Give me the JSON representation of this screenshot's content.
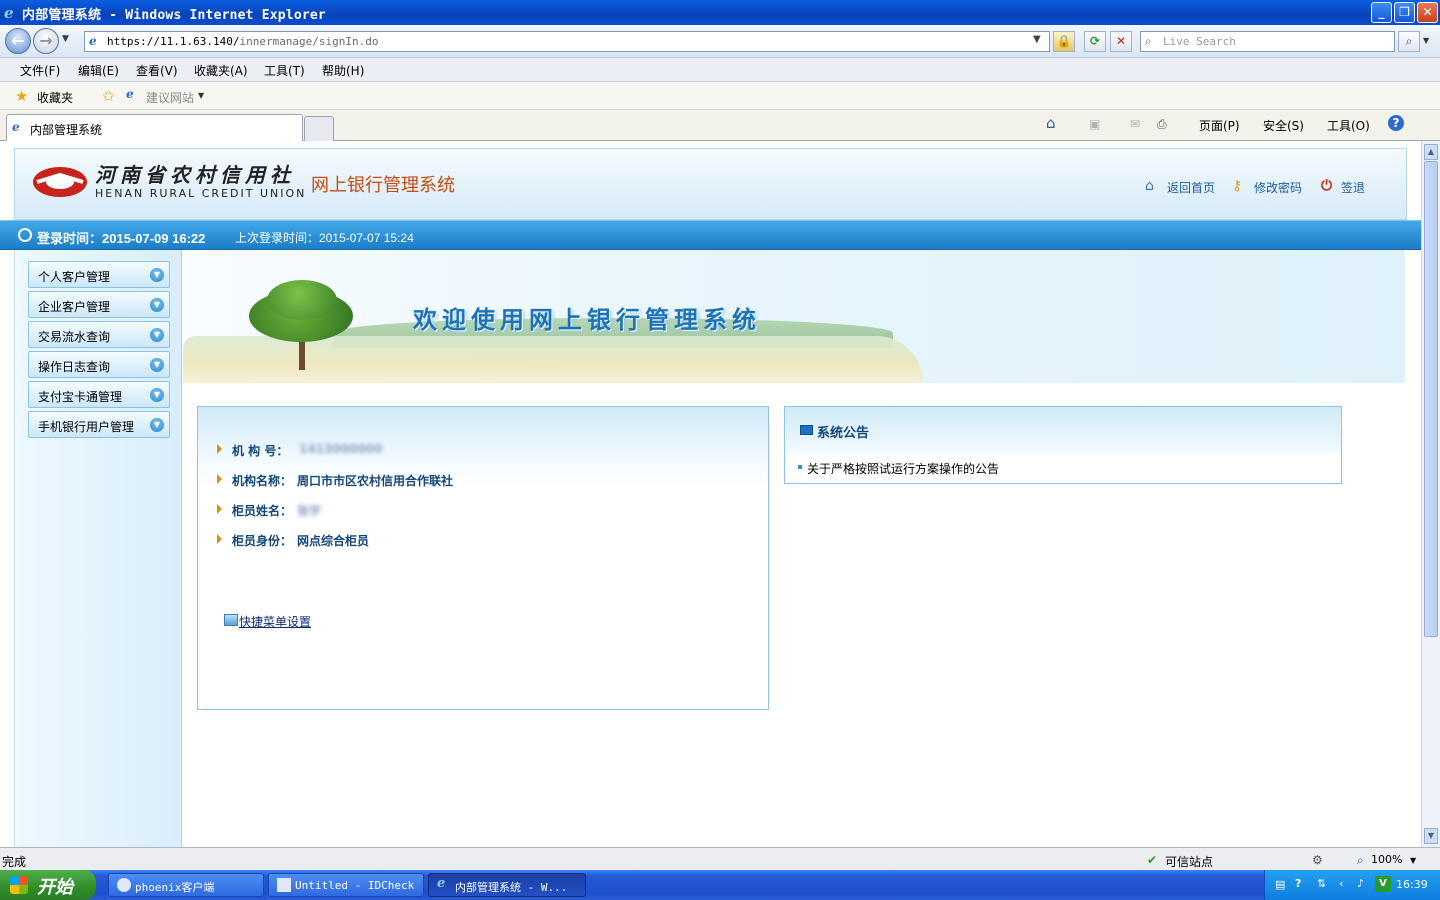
{
  "window": {
    "title": "内部管理系统 - Windows Internet Explorer"
  },
  "browser": {
    "url_scheme_host": "https://11.1.63.140/",
    "url_path": "innermanage/signIn.do",
    "search_placeholder": "Live Search",
    "menu": [
      "文件(F)",
      "编辑(E)",
      "查看(V)",
      "收藏夹(A)",
      "工具(T)",
      "帮助(H)"
    ],
    "favorites_label": "收藏夹",
    "suggested_sites": "建议网站",
    "tab_title": "内部管理系统",
    "commands": {
      "page": "页面(P)",
      "safety": "安全(S)",
      "tools": "工具(O)"
    },
    "status_text": "完成",
    "trusted_zone": "可信站点",
    "zoom": "100%"
  },
  "site": {
    "logo_cn": "河南省农村信用社",
    "logo_en": "HENAN RURAL CREDIT UNION",
    "system_title": "网上银行管理系统",
    "header_links": {
      "home": "返回首页",
      "change_password": "修改密码",
      "logout": "签退"
    },
    "login_time": "登录时间：2015-07-09 16:22",
    "last_login": "上次登录时间：2015-07-07 15:24",
    "welcome": "欢迎使用网上银行管理系统"
  },
  "sidebar": {
    "items": [
      {
        "label": "个人客户管理"
      },
      {
        "label": "企业客户管理"
      },
      {
        "label": "交易流水查询"
      },
      {
        "label": "操作日志查询"
      },
      {
        "label": "支付宝卡通管理"
      },
      {
        "label": "手机银行用户管理"
      }
    ]
  },
  "info": {
    "institution_no_label": "机 构 号：",
    "institution_no_value": "1413000000",
    "institution_name_label": "机构名称：",
    "institution_name_value": "周口市市区农村信用合作联社",
    "teller_name_label": "柜员姓名：",
    "teller_name_value": "张宇",
    "teller_role_label": "柜员身份：",
    "teller_role_value": "网点综合柜员",
    "quick_menu": "快捷菜单设置"
  },
  "notice": {
    "title": "系统公告",
    "items": [
      "关于严格按照试运行方案操作的公告"
    ]
  },
  "taskbar": {
    "start": "开始",
    "items": [
      "phoenix客户端",
      "Untitled - IDCheck",
      "内部管理系统 - W..."
    ],
    "clock": "16:39"
  },
  "colors": {
    "brand_orange": "#c84b12",
    "login_bar_blue": "#1c7dc7",
    "link_blue": "#1a5d99",
    "info_text": "#15477a"
  }
}
